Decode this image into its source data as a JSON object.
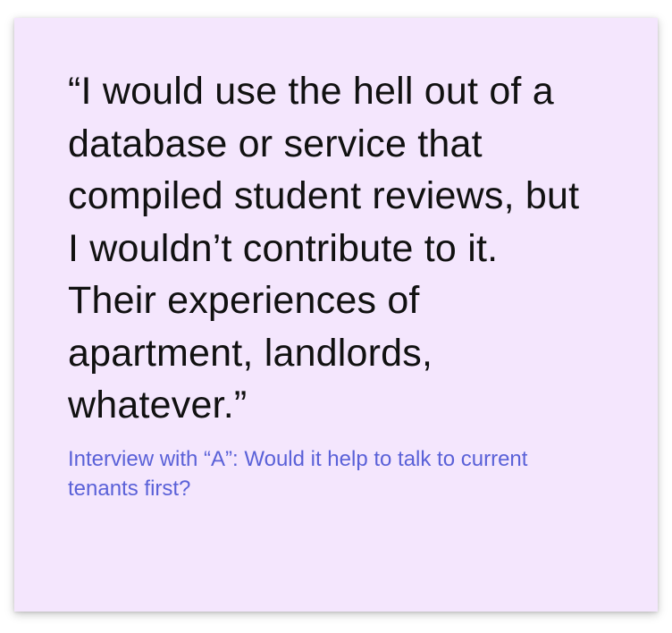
{
  "quote": {
    "text": "“I would use the hell out of a database or service that compiled student reviews, but I wouldn’t contribute to it. Their experiences of apartment, landlords, whatever.”"
  },
  "caption": {
    "text": "Interview with “A”: Would it help to talk to current tenants first?"
  },
  "colors": {
    "card_background": "#f4e6fd",
    "quote_text": "#111111",
    "caption_text": "#5a61d8"
  }
}
